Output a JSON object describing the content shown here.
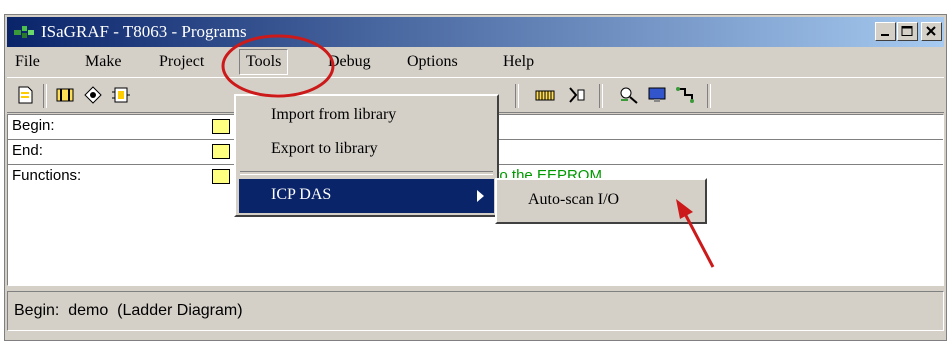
{
  "window": {
    "title": "ISaGRAF - T8063 - Programs"
  },
  "menubar": {
    "items": [
      {
        "label": "File"
      },
      {
        "label": "Make"
      },
      {
        "label": "Project"
      },
      {
        "label": "Tools"
      },
      {
        "label": "Debug"
      },
      {
        "label": "Options"
      },
      {
        "label": "Help"
      }
    ]
  },
  "tools_menu": {
    "items": [
      {
        "label": "Import from library"
      },
      {
        "label": "Export to library"
      },
      {
        "label": "ICP DAS"
      }
    ]
  },
  "icp_submenu": {
    "items": [
      {
        "label": "Auto-scan I/O"
      }
    ]
  },
  "program_list": {
    "rows": [
      {
        "label": "Begin:"
      },
      {
        "label": "End:"
      },
      {
        "label": "Functions:"
      }
    ],
    "partial_comment": "Save an integer to the EEPROM"
  },
  "statusbar": {
    "text": "Begin:  demo  (Ladder Diagram)"
  },
  "colors": {
    "highlight": "#0a246a",
    "annotation_red": "#cc1a1a",
    "comment_green": "#009900"
  }
}
